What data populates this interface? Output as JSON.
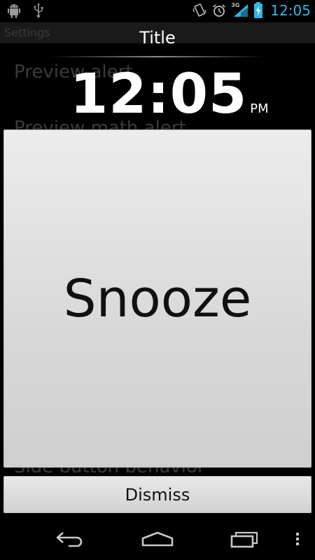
{
  "status_bar": {
    "network_type": "3G",
    "time": "12:05",
    "icons": [
      "android-debug-icon",
      "usb-icon",
      "vibrate-icon",
      "alarm-icon",
      "signal-icon",
      "battery-charging-icon"
    ]
  },
  "background": {
    "action_bar_title": "Settings",
    "items": [
      "Preview alert",
      "Preview math alert",
      "Side button behavior"
    ]
  },
  "dialog": {
    "title": "Title",
    "clock": {
      "time": "12:05",
      "ampm": "PM"
    },
    "snooze_label": "Snooze",
    "dismiss_label": "Dismiss"
  },
  "nav_bar": {
    "icons": [
      "back-icon",
      "home-icon",
      "recent-apps-icon",
      "overflow-menu-icon"
    ]
  },
  "colors": {
    "status_time": "#33b5e5",
    "button_face": "#dcdcdc",
    "background": "#000000"
  }
}
